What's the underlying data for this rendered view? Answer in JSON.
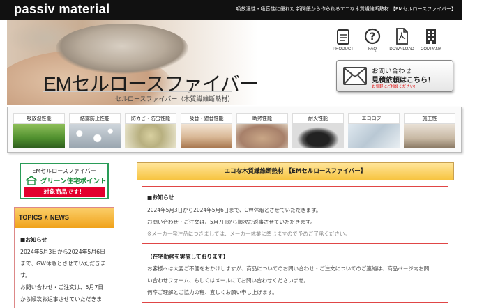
{
  "header": {
    "logo": "passiv material",
    "tagline": "吸放湿性・吸音性に優れた 新聞紙から作られるエコな木質繊維断熱材 【EMセルロースファイバー】"
  },
  "hero": {
    "title": "EMセルロースファイバー",
    "subtitle": "セルロースファイバー（木質繊維断熱材）"
  },
  "nav": [
    {
      "label": "PRODUCT",
      "icon": "clipboard-icon"
    },
    {
      "label": "FAQ",
      "icon": "question-icon"
    },
    {
      "label": "DOWNLOAD",
      "icon": "pdf-icon"
    },
    {
      "label": "COMPANY",
      "icon": "building-icon"
    }
  ],
  "contact": {
    "line1": "お問い合わせ",
    "line2": "見積依頼はこちら！",
    "line3": "お気軽にご相談ください!!"
  },
  "categories": [
    {
      "label": "吸放湿性能",
      "image": "forest-image"
    },
    {
      "label": "結露防止性能",
      "image": "droplets-image"
    },
    {
      "label": "防カビ・防虫性能",
      "image": "mold-image"
    },
    {
      "label": "吸音・遮音性能",
      "image": "room-image"
    },
    {
      "label": "断熱性能",
      "image": "fiber-image"
    },
    {
      "label": "耐火性能",
      "image": "burner-image"
    },
    {
      "label": "エコロジー",
      "image": "recycle-image"
    },
    {
      "label": "施工性",
      "image": "install-image"
    }
  ],
  "sidebar": {
    "badge": {
      "line1": "EMセルロースファイバー",
      "line2": "グリーン住宅ポイント",
      "line3": "対象商品です！"
    },
    "topics": {
      "title": "TOPICS ∧ NEWS",
      "heading": "■お知らせ",
      "lines": [
        "2024年5月3日から2024年5月6日",
        "まで、GW休暇とさせていただきま",
        "す。",
        "お問い合わせ・ご注文は、5月7日",
        "から順次お返事させていただきま"
      ]
    }
  },
  "main": {
    "heading": "エコな木質繊維断熱材 【EMセルロースファイバー】",
    "notice1": {
      "title": "■お知らせ",
      "lines": [
        "2024年5月3日から2024年5月6日まで、GW休暇とさせていただきます。",
        "お問い合わせ・ご注文は、5月7日から順次お返事させていただきます。",
        "※メーカー発注品につきましては、メーカー休業に準じますので予めご了承ください。"
      ]
    },
    "notice2": {
      "title": "【在宅勤務を実施しております】",
      "lines": [
        "お客様へは大変ご不便をおかけしますが、商品についてのお問い合わせ・ご注文についてのご連絡は、商品ページ内お問",
        "い合わせフォーム、もしくはメールにてお問い合わせくださいませ。",
        "何卒ご理解とご協力の程、宜しくお願い申し上げます。"
      ]
    }
  },
  "colors": {
    "topbar": "#111111",
    "accent_orange": "#f0a21a",
    "notice_border": "#e04646",
    "green": "#2a9c58",
    "red": "#e3002d"
  }
}
